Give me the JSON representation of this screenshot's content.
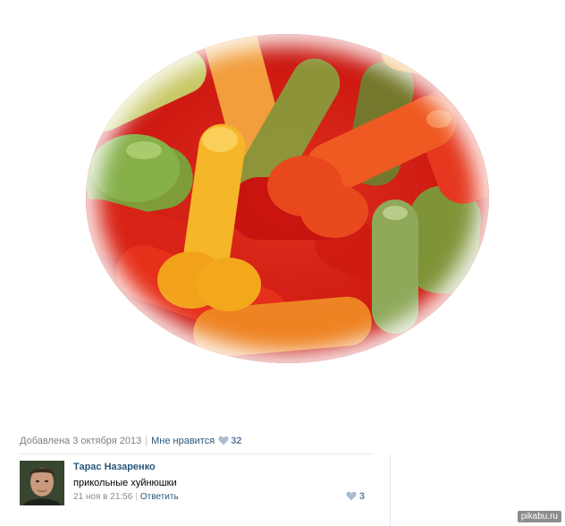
{
  "post": {
    "added_label": "Добавлена 3 октября 2013",
    "like_link": "Мне нравится",
    "like_count": "32"
  },
  "comment": {
    "author": "Тарас Назаренко",
    "text": "прикольные хуйнюшки",
    "date": "21 ноя в 21:56",
    "reply_label": "Ответить",
    "like_count": "3"
  },
  "watermark": "pikabu.ru",
  "colors": {
    "link": "#2b587a",
    "muted": "#7f7f7f",
    "heart": "#a8bdd3"
  }
}
